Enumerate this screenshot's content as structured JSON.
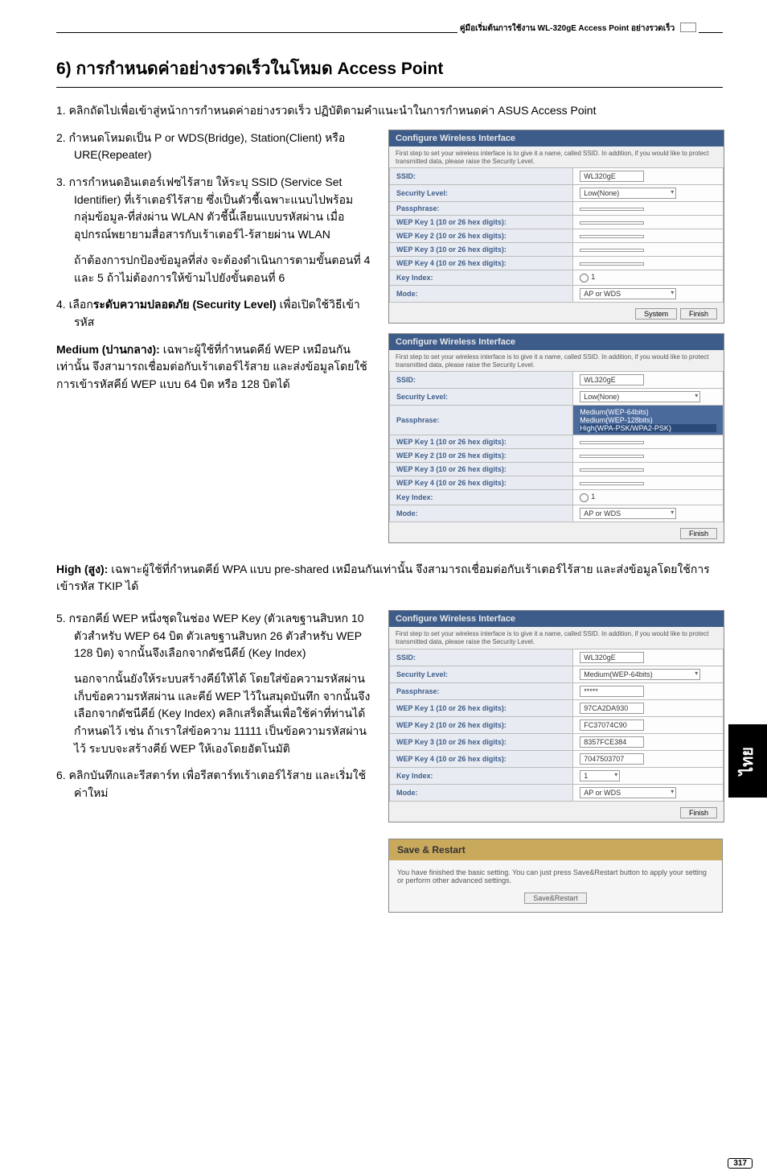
{
  "header": {
    "doc_title": "คู่มือเริ่มต้นการใช้งาน WL-320gE Access Point อย่างรวดเร็ว"
  },
  "title": "6) การกำหนดค่าอย่างรวดเร็วในโหมด Access Point",
  "steps": {
    "s1": "1.  คลิกถัดไปเพื่อเข้าสู่หน้าการกำหนดค่าอย่างรวดเร็ว ปฏิบัติตามคำแนะนำในการกำหนดค่า ASUS Access Point",
    "s2": "2.  กำหนดโหมดเป็น P or WDS(Bridge), Station(Client) หรือ URE(Repeater)",
    "s3": "3.  การกำหนดอินเตอร์เฟซไร้สาย ให้ระบุ SSID (Service Set Identifier) ที่เร้าเตอร์ไร้สาย ซึ่งเป็นตัวชี้เฉพาะแนบไปพร้อมกลุ่มข้อมูล-ที่ส่งผ่าน WLAN ตัวชี้นี้เลียนแบบรหัสผ่าน เมื่ออุปกรณ์พยายามสื่อสารกับเร้าเตอร์ไ-ร้สายผ่าน WLAN",
    "s3b": "ถ้าต้องการปกป้องข้อมูลที่ส่ง จะต้องดำเนินการตามขั้นตอนที่ 4 และ 5 ถ้าไม่ต้องการให้ข้ามไปยังขั้นตอนที่ 6",
    "s4": "4.  เลือกระดับความปลอดภัย (Security Level) เพื่อเปิดใช้วิธีเข้ารหัส",
    "medium_h": "Medium (ปานกลาง): ",
    "medium_t": "เฉพาะผู้ใช้ที่กำหนดคีย์ WEP เหมือนกันเท่านั้น จึงสามารถเชื่อมต่อกับเร้าเตอร์ไร้สาย และส่งข้อมูลโดยใช้การเข้ารหัสคีย์ WEP แบบ 64 บิต หรือ 128 บิตได้",
    "high_h": "High (สูง): ",
    "high_t": "เฉพาะผู้ใช้ที่กำหนดคีย์ WPA แบบ pre-shared เหมือนกันเท่านั้น จึงสามารถเชื่อมต่อกับเร้าเตอร์ไร้สาย และส่งข้อมูลโดยใช้การเข้ารหัส TKIP ได้",
    "s5": "5.  กรอกคีย์ WEP หนึ่งชุดในช่อง WEP Key (ตัวเลขฐานสิบหก 10 ตัวสำหรับ WEP 64 บิต ตัวเลขฐานสิบหก 26 ตัวสำหรับ WEP 128 บิต) จากนั้นจึงเลือกจากดัชนีคีย์ (Key Index)",
    "s5b": "นอกจากนั้นยังให้ระบบสร้างคีย์ให้ได้ โดยใส่ข้อความรหัสผ่าน เก็บข้อความรหัสผ่าน และคีย์ WEP ไว้ในสมุดบันทึก จากนั้นจึงเลือกจากดัชนีคีย์ (Key Index) คลิกเสร็ดสิ้นเพื่อใช้ค่าที่ท่านได้กำหนดไว้ เช่น ถ้าเราใส่ข้อความ 11111 เป็นข้อความรหัสผ่านไว้ ระบบจะสร้างคีย์ WEP ให้เองโดยอัตโนมัติ",
    "s6": "6.  คลิกบันทึกและรีสตาร์ท เพื่อรีสตาร์ทเร้าเตอร์ไร้สาย และเริ่มใช้ค่าใหม่"
  },
  "panel_common": {
    "title": "Configure Wireless Interface",
    "desc": "First step to set your wireless interface is to give it a name, called SSID. In addition, if you would like to protect transmitted data, please raise the Security Level.",
    "ssid_label": "SSID:",
    "sec_label": "Security Level:",
    "pass_label": "Passphrase:",
    "k1": "WEP Key 1 (10 or 26 hex digits):",
    "k2": "WEP Key 2 (10 or 26 hex digits):",
    "k3": "WEP Key 3 (10 or 26 hex digits):",
    "k4": "WEP Key 4 (10 or 26 hex digits):",
    "idx": "Key Index:",
    "mode": "Mode:",
    "finish": "Finish"
  },
  "panel1": {
    "ssid": "WL320gE",
    "sec": "Low(None)",
    "idx_val": "1",
    "mode_val": "AP or WDS",
    "btn2": "System"
  },
  "panel2": {
    "ssid": "WL320gE",
    "sec": "Low(None)",
    "opt1": "Medium(WEP-64bits)",
    "opt2": "Medium(WEP-128bits)",
    "opt3": "High(WPA-PSK/WPA2-PSK)",
    "idx_val": "1",
    "mode_val": "AP or WDS"
  },
  "panel3": {
    "ssid": "WL320gE",
    "sec": "Medium(WEP-64bits)",
    "pass": "*****",
    "k1v": "97CA2DA930",
    "k2v": "FC37074C90",
    "k3v": "8357FCE384",
    "k4v": "7047503707",
    "idx_val": "1",
    "mode_val": "AP or WDS"
  },
  "save_panel": {
    "title": "Save & Restart",
    "body": "You have finished the basic setting. You can just press Save&Restart button to apply your setting or perform other advanced settings.",
    "btn": "Save&Restart"
  },
  "side_tab": "ไทย",
  "page_num": "317"
}
